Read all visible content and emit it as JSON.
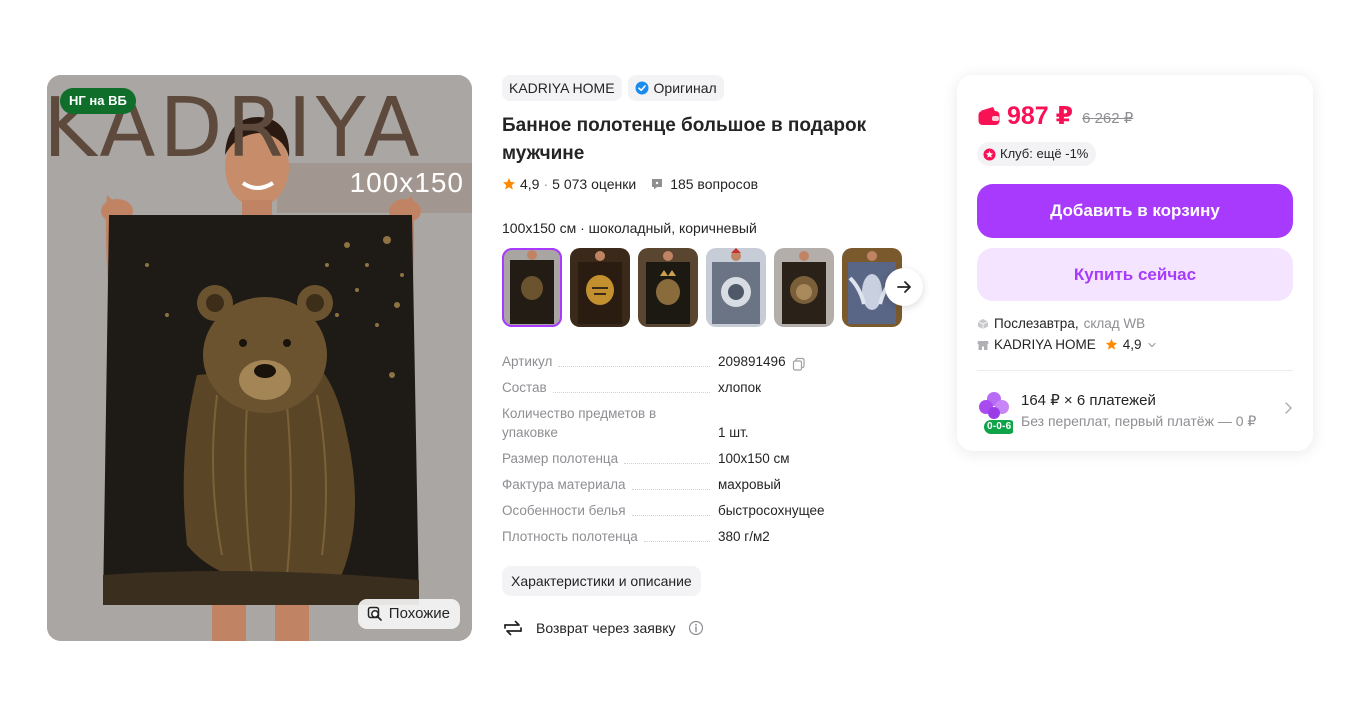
{
  "photo": {
    "badge": "НГ на ВБ",
    "brand_text": "KADRIYA",
    "size_text": "100x150",
    "similar_label": "Похожие"
  },
  "product": {
    "brand": "KADRIYA HOME",
    "original_label": "Оригинал",
    "title": "Банное полотенце большое в подарок мужчине",
    "rating": "4,9",
    "rating_sep": "·",
    "reviews": "5 073 оценки",
    "questions": "185 вопросов",
    "variant": "100x150 см · шоколадный, коричневый"
  },
  "thumbnails": [
    {
      "name": "bear",
      "selected": true
    },
    {
      "name": "tiger",
      "selected": false
    },
    {
      "name": "lion-crown",
      "selected": false
    },
    {
      "name": "santa-bw",
      "selected": false
    },
    {
      "name": "lion",
      "selected": false
    },
    {
      "name": "angel",
      "selected": false
    }
  ],
  "specs": [
    {
      "key": "Артикул",
      "value": "209891496"
    },
    {
      "key": "Состав",
      "value": "хлопок"
    },
    {
      "key": "Количество предметов в упаковке",
      "value": "1 шт."
    },
    {
      "key": "Размер полотенца",
      "value": "100x150 см"
    },
    {
      "key": "Фактура материала",
      "value": "махровый"
    },
    {
      "key": "Особенности белья",
      "value": "быстросохнущее"
    },
    {
      "key": "Плотность полотенца",
      "value": "380 г/м2"
    }
  ],
  "characteristics_label": "Характеристики и описание",
  "return_label": "Возврат через заявку",
  "buy": {
    "price": "987 ₽",
    "old_price": "6 262 ₽",
    "club": "Клуб: ещё -1%",
    "add_to_cart": "Добавить в корзину",
    "buy_now": "Купить сейчас",
    "delivery_main": "Послезавтра,",
    "delivery_sub": "склад WB",
    "seller_name": "KADRIYA HOME",
    "seller_rating": "4,9",
    "installment_title": "164 ₽ × 6 платежей",
    "installment_sub": "Без переплат, первый платёж — 0 ₽",
    "installment_badge": "0-0-6"
  },
  "colors": {
    "accent": "#a73afd",
    "accent_light": "#f5e4ff",
    "price": "#f91155",
    "badge_green": "#0e6e2a",
    "muted": "#8e8e93"
  }
}
